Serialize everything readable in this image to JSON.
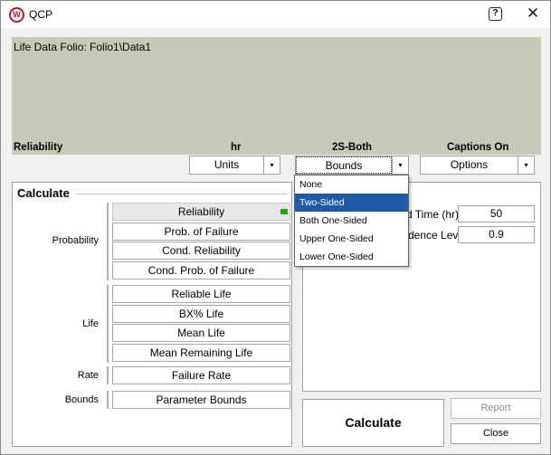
{
  "window": {
    "title": "QCP",
    "logo_letter": "W",
    "help_glyph": "?",
    "close_glyph": "✕"
  },
  "info": {
    "folio": "Life Data Folio: Folio1\\Data1",
    "status_function": "Reliability",
    "status_units": "hr",
    "status_bounds": "2S-Both",
    "status_captions": "Captions On"
  },
  "combos": {
    "units": "Units",
    "bounds": "Bounds",
    "options": "Options",
    "arrow": "▾"
  },
  "calculate": {
    "title": "Calculate",
    "categories": {
      "probability": "Probability",
      "life": "Life",
      "rate": "Rate",
      "bounds": "Bounds"
    },
    "buttons": {
      "reliability": "Reliability",
      "prob_failure": "Prob. of Failure",
      "cond_reliability": "Cond. Reliability",
      "cond_prob_failure": "Cond. Prob. of Failure",
      "reliable_life": "Reliable Life",
      "bx_life": "BX% Life",
      "mean_life": "Mean Life",
      "mean_remaining_life": "Mean Remaining Life",
      "failure_rate": "Failure Rate",
      "parameter_bounds": "Parameter Bounds"
    }
  },
  "params": {
    "mission_time_label": "d Time (hr)",
    "mission_time_value": "50",
    "confidence_label": "dence Level",
    "confidence_value": "0.9"
  },
  "actions": {
    "calculate": "Calculate",
    "report": "Report",
    "close": "Close"
  },
  "bounds_dropdown": {
    "items": [
      "None",
      "Two-Sided",
      "Both One-Sided",
      "Upper One-Sided",
      "Lower One-Sided"
    ],
    "selected": "Two-Sided"
  },
  "colors": {
    "highlight": "#1e5aa8",
    "info_panel": "#c8cab8",
    "selected_marker": "#19a919",
    "logo": "#c8102e"
  }
}
